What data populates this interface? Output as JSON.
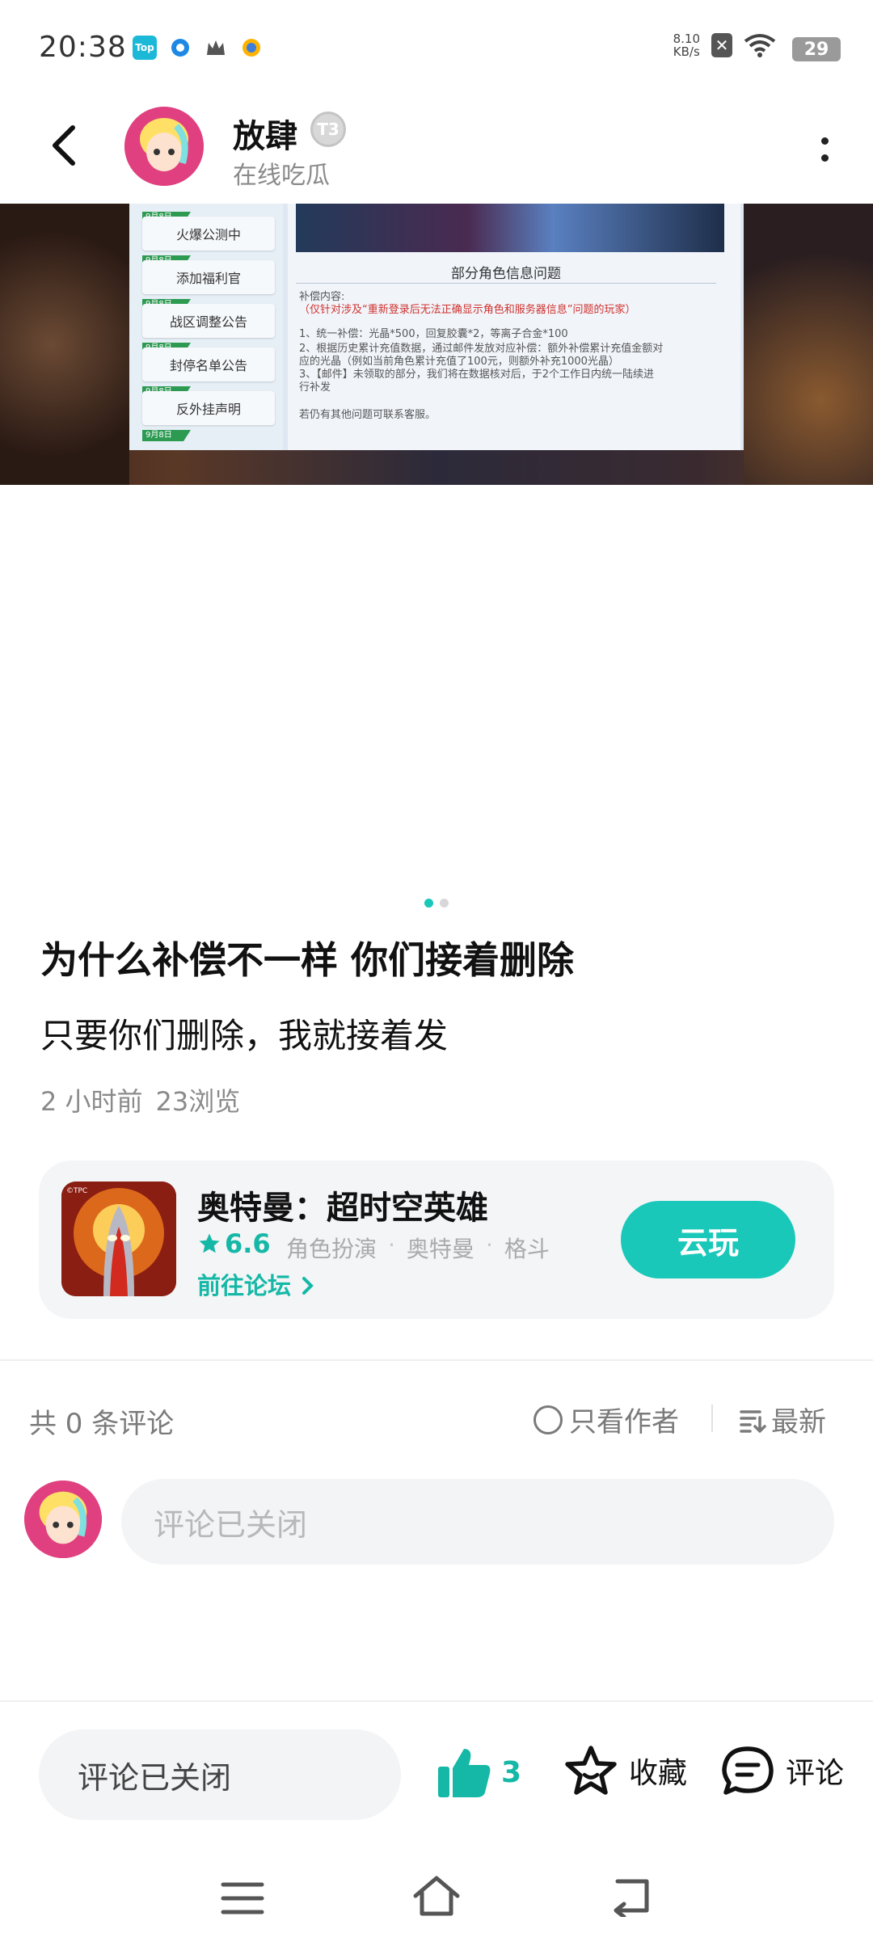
{
  "status_bar": {
    "time": "20:38",
    "app_icons": [
      "top-news-app-icon",
      "browser-app-icon",
      "crown-app-icon",
      "qq-app-icon"
    ],
    "net_speed_value": "8.10",
    "net_speed_unit": "KB/s",
    "battery": "29"
  },
  "header": {
    "author_name": "放肆",
    "level_badge": "T3",
    "author_status": "在线吃瓜"
  },
  "banner": {
    "menu_items": [
      {
        "tag": "9月8日",
        "label": "火爆公测中"
      },
      {
        "tag": "9月8日",
        "label": "添加福利官"
      },
      {
        "tag": "9月8日",
        "label": "战区调整公告"
      },
      {
        "tag": "9月8日",
        "label": "封停名单公告"
      },
      {
        "tag": "9月8日",
        "label": "反外挂声明"
      },
      {
        "tag": "9月8日",
        "label": ""
      }
    ],
    "notice_title": "部分角色信息问题",
    "notice_lines": [
      "补偿内容:",
      "（仅针对涉及“重新登录后无法正确显示角色和服务器信息”问题的玩家）",
      "1、统一补偿：光晶*500，回复胶囊*2，等离子合金*100",
      "2、根据历史累计充值数据，通过邮件发放对应补偿：额外补偿累计充值金额对",
      "应的光晶（例如当前角色累计充值了100元，则额外补充1000光晶）",
      "3、【邮件】未领取的部分，我们将在数据核对后，于2个工作日内统一陆续进",
      "行补发",
      "若仍有其他问题可联系客服。"
    ],
    "carousel_total": 2,
    "carousel_active": 1
  },
  "post": {
    "title": "为什么补偿不一样 你们接着删除",
    "body": "只要你们删除，我就接着发",
    "time_ago": "2 小时前",
    "views": "23浏览"
  },
  "game_card": {
    "icon_label": "©TPC",
    "name": "奥特曼：超时空英雄",
    "rating": "6.6",
    "tags": [
      "角色扮演",
      "奥特曼",
      "格斗"
    ],
    "tag_separator": "·",
    "forum_link": "前往论坛",
    "play_button": "云玩"
  },
  "comments": {
    "count_label": "共 0 条评论",
    "only_author": "只看作者",
    "sort": "最新",
    "input_placeholder": "评论已关闭"
  },
  "bottom_bar": {
    "closed_label": "评论已关闭",
    "like_count": "3",
    "favorite_label": "收藏",
    "comment_label": "评论"
  },
  "colors": {
    "accent": "#19c8b9",
    "accent_text": "#15b8a6",
    "avatar_bg": "#e0407f"
  }
}
